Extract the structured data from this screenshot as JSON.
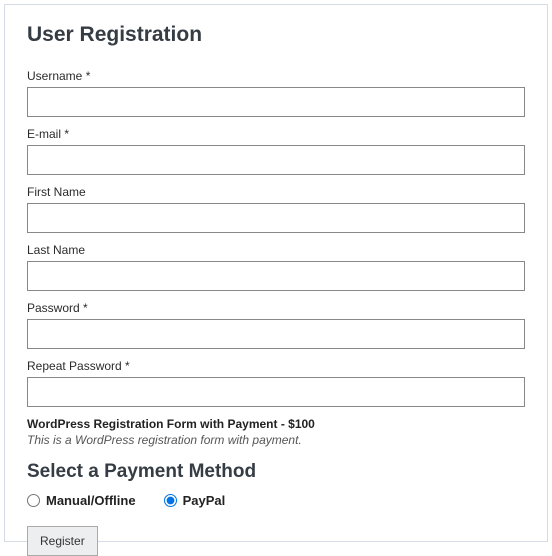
{
  "title": "User Registration",
  "fields": {
    "username": {
      "label": "Username *",
      "value": ""
    },
    "email": {
      "label": "E-mail *",
      "value": ""
    },
    "firstname": {
      "label": "First Name",
      "value": ""
    },
    "lastname": {
      "label": "Last Name",
      "value": ""
    },
    "password": {
      "label": "Password *",
      "value": ""
    },
    "repeatpassword": {
      "label": "Repeat Password *",
      "value": ""
    }
  },
  "plan": {
    "line": "WordPress Registration Form with Payment - $100",
    "desc": "This is a WordPress registration form with payment."
  },
  "payment": {
    "title": "Select a Payment Method",
    "options": {
      "manual": {
        "label": "Manual/Offline",
        "selected": false
      },
      "paypal": {
        "label": "PayPal",
        "selected": true
      }
    }
  },
  "submit": {
    "label": "Register"
  }
}
